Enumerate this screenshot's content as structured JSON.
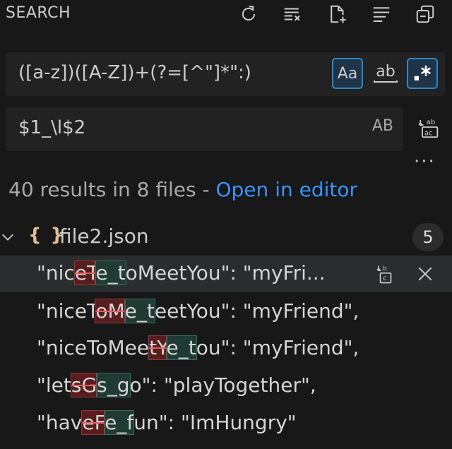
{
  "header": {
    "title": "SEARCH",
    "icons": [
      "refresh-icon",
      "clear-results-icon",
      "new-search-editor-icon",
      "view-as-tree-icon",
      "collapse-all-icon"
    ]
  },
  "search": {
    "value": "([a-z])([A-Z])+(?=[^\"]*\":)",
    "options": {
      "match_case": "Aa",
      "whole_word": "ab",
      "regex": ".*"
    }
  },
  "replace": {
    "value": "$1_\\l$2",
    "preserve_case": "AB"
  },
  "more_label": "···",
  "summary": {
    "text": "40 results in 8 files - ",
    "link": "Open in editor"
  },
  "file": {
    "icon": "{ }",
    "name": "file2.json",
    "count": "5"
  },
  "matches": [
    {
      "pre": "\"nic",
      "del": "eT",
      "ins": "e_t",
      "post": "oMeetYou\": \"myFri..."
    },
    {
      "pre": "\"niceT",
      "del": "oM",
      "ins": "e_t",
      "post": "eetYou\": \"myFriend\","
    },
    {
      "pre": "\"niceToMee",
      "del": "tY",
      "ins": "e_t",
      "post": "ou\": \"myFriend\","
    },
    {
      "pre": "\"let",
      "del": "sG",
      "ins": "s_g",
      "post": "o\": \"playTogether\","
    },
    {
      "pre": "\"hav",
      "del": "eF",
      "ins": "e_f",
      "post": "un\": \"ImHungry\""
    }
  ],
  "colors": {
    "background": "#181818",
    "input_bg": "#222222",
    "accent": "#3794ff",
    "deleted_bg": "#5a1d1d",
    "inserted_bg": "#1f3b34"
  }
}
